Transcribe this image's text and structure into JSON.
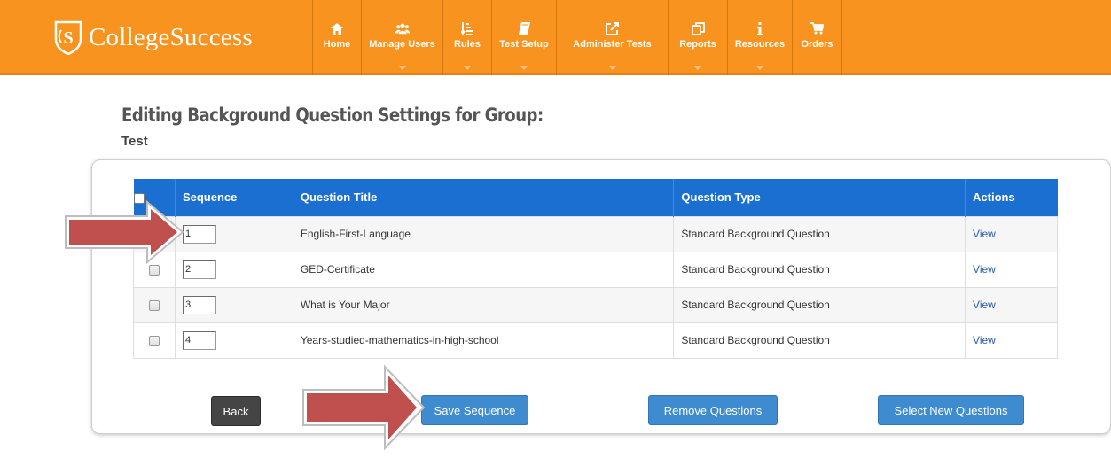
{
  "brand": {
    "name": "CollegeSuccess"
  },
  "nav": [
    {
      "label": "Home",
      "icon": "home-icon",
      "dropdown": false,
      "width": 55
    },
    {
      "label": "Manage Users",
      "icon": "users-icon",
      "dropdown": true,
      "width": 92
    },
    {
      "label": "Rules",
      "icon": "sort-icon",
      "dropdown": true,
      "width": 55
    },
    {
      "label": "Test Setup",
      "icon": "book-icon",
      "dropdown": true,
      "width": 73
    },
    {
      "label": "Administer Tests",
      "icon": "external-link-icon",
      "dropdown": true,
      "width": 126
    },
    {
      "label": "Reports",
      "icon": "copy-icon",
      "dropdown": true,
      "width": 67
    },
    {
      "label": "Resources",
      "icon": "info-icon",
      "dropdown": true,
      "width": 73
    },
    {
      "label": "Orders",
      "icon": "cart-icon",
      "dropdown": false,
      "width": 57
    }
  ],
  "page": {
    "title": "Editing Background Question Settings for Group:",
    "group": "Test"
  },
  "table": {
    "headers": {
      "sequence": "Sequence",
      "title": "Question Title",
      "type": "Question Type",
      "actions": "Actions"
    },
    "rows": [
      {
        "sequence": "1",
        "title": "English-First-Language",
        "type": "Standard Background Question",
        "action": "View"
      },
      {
        "sequence": "2",
        "title": "GED-Certificate",
        "type": "Standard Background Question",
        "action": "View"
      },
      {
        "sequence": "3",
        "title": "What is Your Major",
        "type": "Standard Background Question",
        "action": "View"
      },
      {
        "sequence": "4",
        "title": "Years-studied-mathematics-in-high-school",
        "type": "Standard Background Question",
        "action": "View"
      }
    ]
  },
  "buttons": {
    "back": "Back",
    "save": "Save Sequence",
    "remove": "Remove Questions",
    "select": "Select New Questions"
  },
  "colors": {
    "nav_bg": "#f7931e",
    "table_header": "#1a6fd1",
    "primary_button": "#3f8bd0",
    "annotation_arrow": "#c0504d"
  }
}
